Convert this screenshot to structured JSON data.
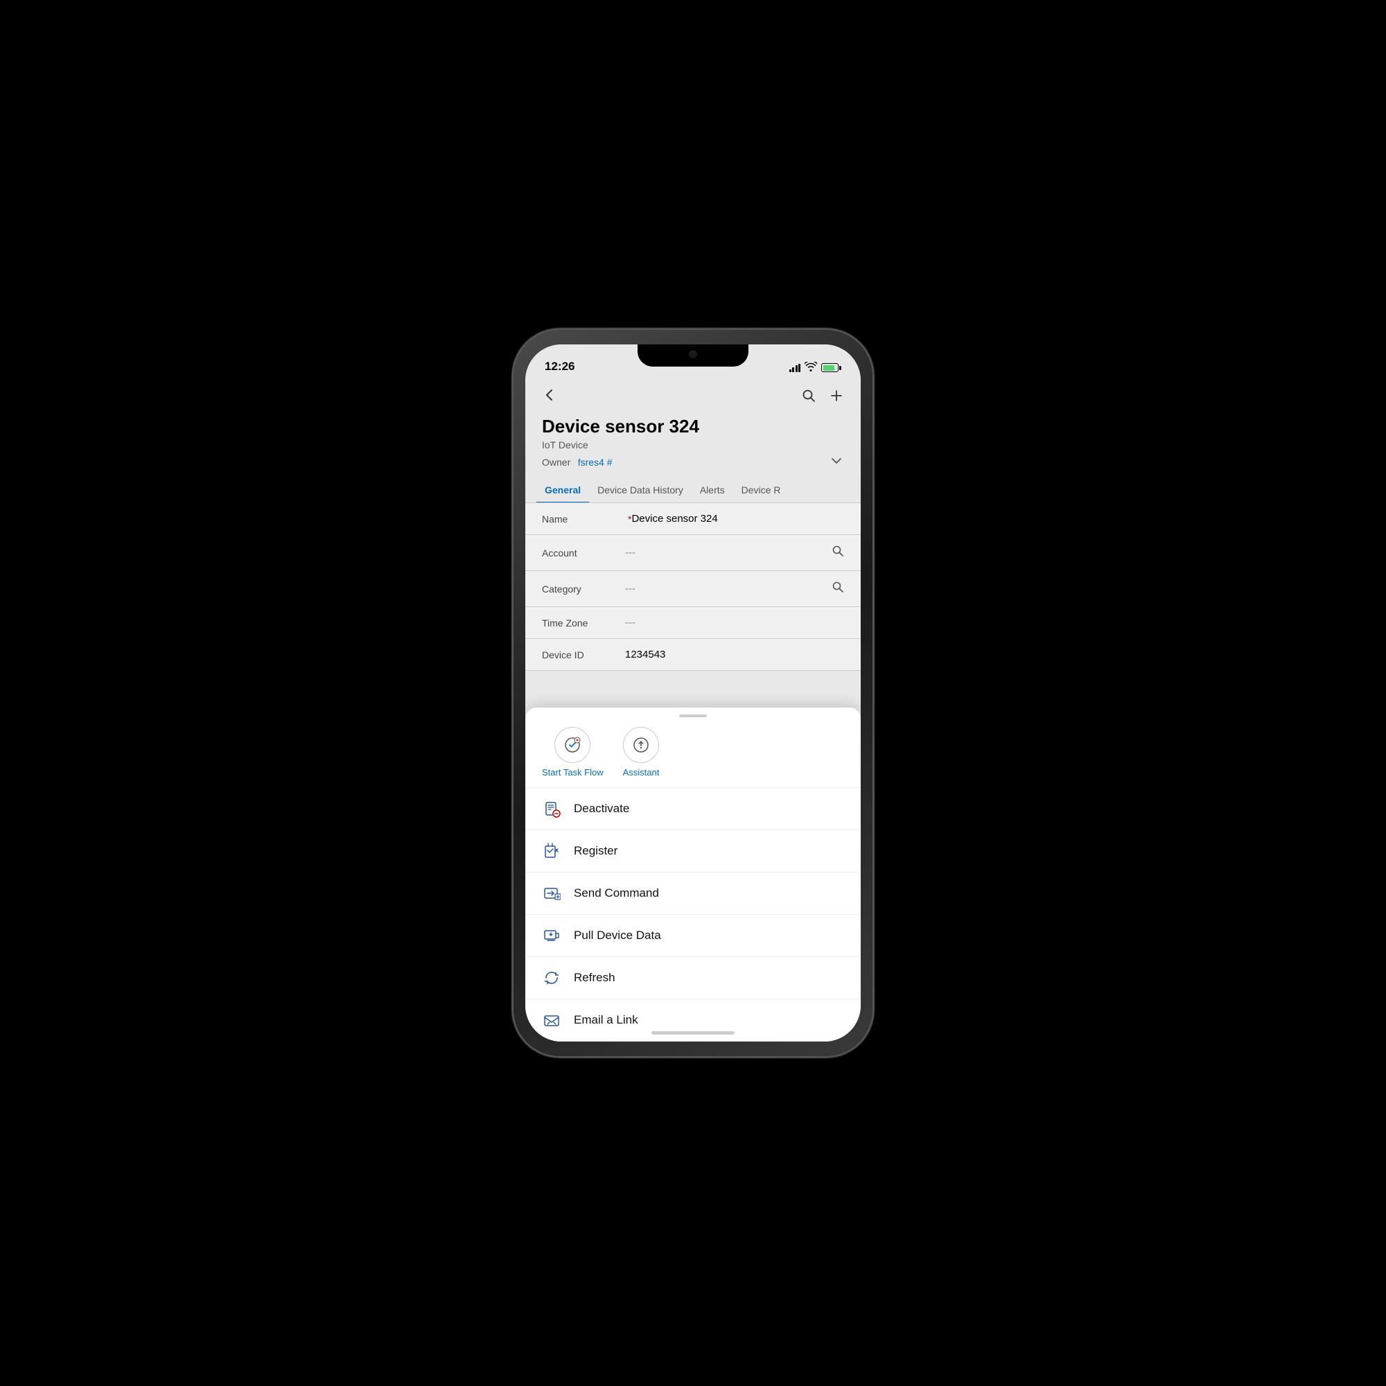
{
  "statusBar": {
    "time": "12:26"
  },
  "navigation": {
    "back_label": "‹",
    "search_label": "⌕",
    "add_label": "+"
  },
  "device": {
    "title": "Device sensor 324",
    "type": "IoT Device",
    "owner_label": "Owner",
    "owner_link": "fsres4 #",
    "fields": [
      {
        "label": "Name",
        "value": "Device sensor 324",
        "required": true,
        "has_search": false,
        "is_placeholder": false
      },
      {
        "label": "Account",
        "value": "---",
        "required": false,
        "has_search": true,
        "is_placeholder": true
      },
      {
        "label": "Category",
        "value": "---",
        "required": false,
        "has_search": true,
        "is_placeholder": true
      },
      {
        "label": "Time Zone",
        "value": "---",
        "required": false,
        "has_search": false,
        "is_placeholder": true
      },
      {
        "label": "Device ID",
        "value": "1234543",
        "required": false,
        "has_search": false,
        "is_placeholder": false
      }
    ]
  },
  "tabs": [
    {
      "label": "General",
      "active": true
    },
    {
      "label": "Device Data History",
      "active": false
    },
    {
      "label": "Alerts",
      "active": false
    },
    {
      "label": "Device R",
      "active": false
    }
  ],
  "quickActions": [
    {
      "label": "Start Task Flow",
      "icon": "task-flow-icon"
    },
    {
      "label": "Assistant",
      "icon": "assistant-icon"
    }
  ],
  "menuItems": [
    {
      "label": "Deactivate",
      "icon": "deactivate-icon"
    },
    {
      "label": "Register",
      "icon": "register-icon"
    },
    {
      "label": "Send Command",
      "icon": "send-command-icon"
    },
    {
      "label": "Pull Device Data",
      "icon": "pull-device-data-icon"
    },
    {
      "label": "Refresh",
      "icon": "refresh-icon"
    },
    {
      "label": "Email a Link",
      "icon": "email-link-icon"
    }
  ],
  "colors": {
    "accent": "#0070c0",
    "required": "#cc0000",
    "tab_active": "#0070c0"
  }
}
